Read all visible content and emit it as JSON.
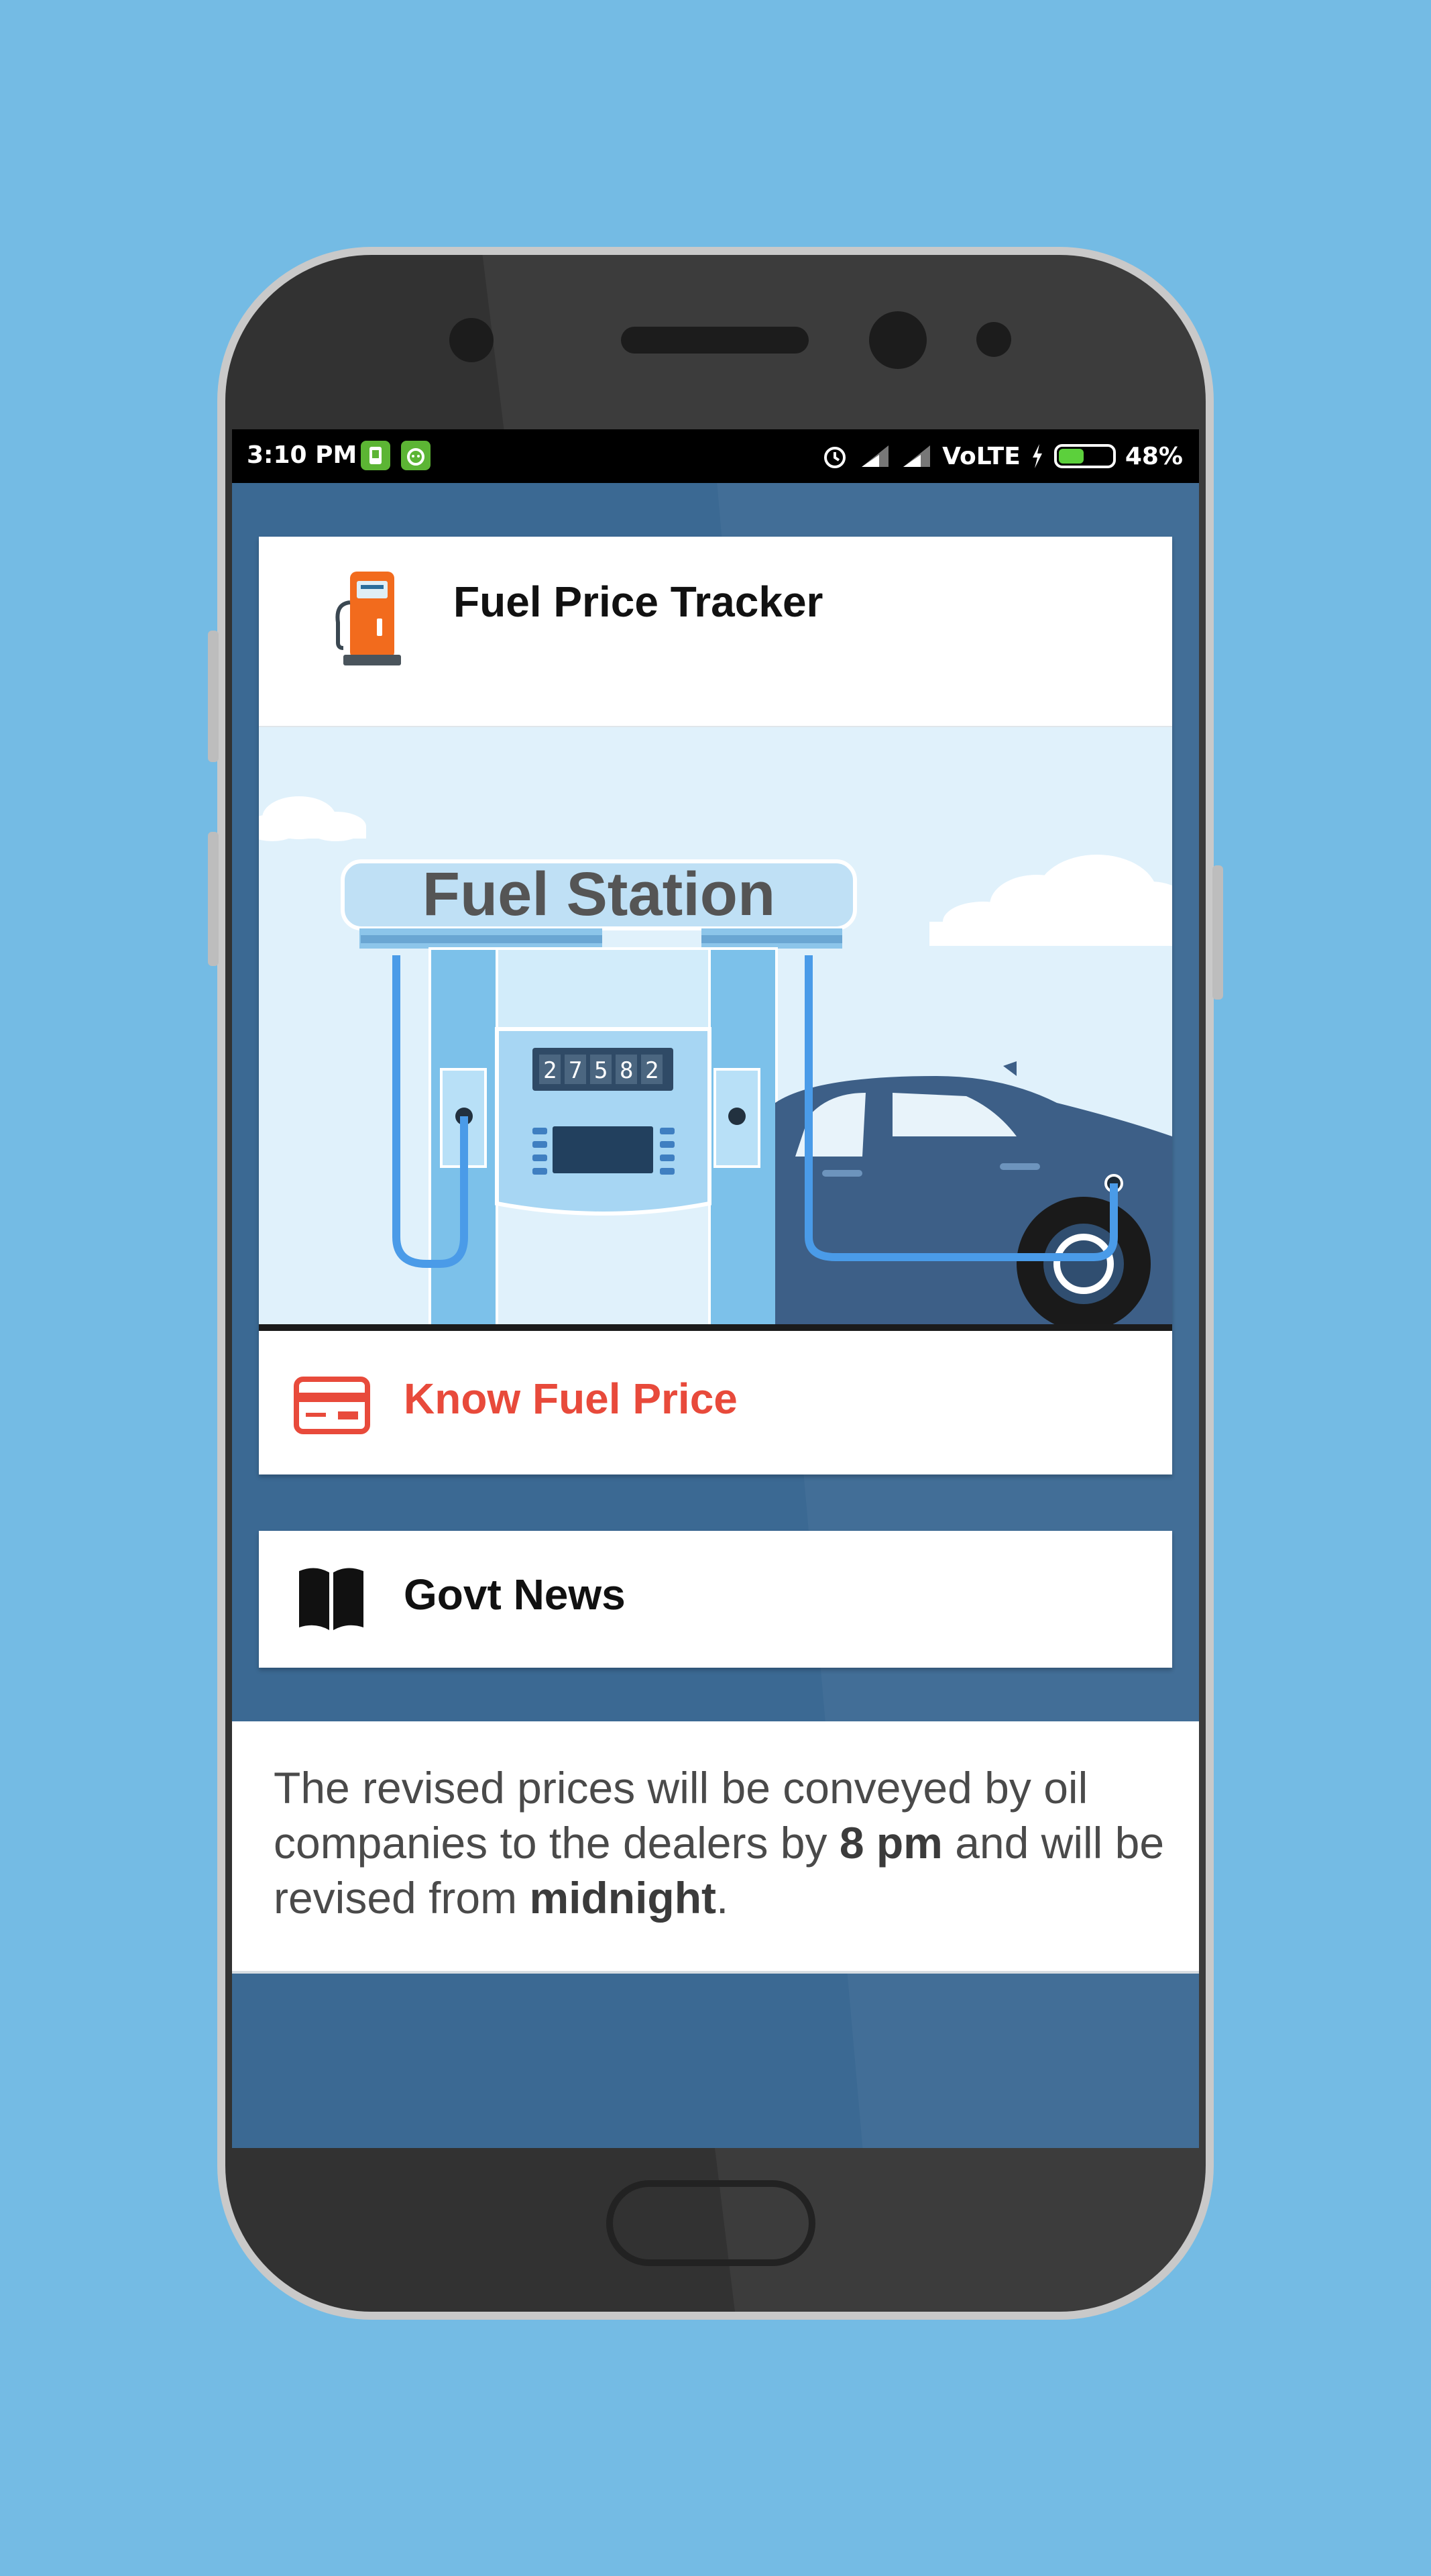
{
  "status_bar": {
    "time": "3:10 PM",
    "network": "VoLTE",
    "battery": "48%",
    "battery_level": 0.48
  },
  "header": {
    "app_title": "Fuel Price Tracker",
    "icon": "fuel-pump-icon"
  },
  "banner": {
    "sign_text": "Fuel Station",
    "meter_digits": [
      "2",
      "7",
      "5",
      "8",
      "2"
    ]
  },
  "menu": {
    "know_price": {
      "label": "Know Fuel Price",
      "icon": "card-icon",
      "color": "#e84a3b"
    },
    "govt_news": {
      "label": "Govt News",
      "icon": "book-icon"
    }
  },
  "info": {
    "part1": "The revised prices will be conveyed by oil companies to the dealers by ",
    "bold1": "8 pm",
    "part2": " and will be revised from ",
    "bold2": "midnight",
    "part3": "."
  },
  "colors": {
    "background": "#74bbe4",
    "screen": "#3b6993",
    "accent_red": "#e84a3b"
  }
}
